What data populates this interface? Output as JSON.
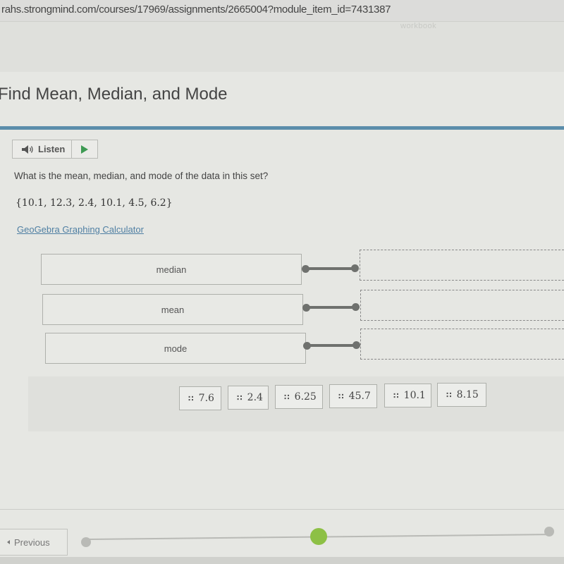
{
  "browser": {
    "url": "rahs.strongmind.com/courses/17969/assignments/2665004?module_item_id=7431387",
    "faded_tab_label": "workbook"
  },
  "page": {
    "title": "Find Mean, Median, and Mode",
    "accent_color": "#5b8dab"
  },
  "listen": {
    "label": "Listen",
    "speaker_icon": "speaker-icon",
    "play_icon": "play-icon",
    "play_color": "#3e9a53"
  },
  "question": {
    "prompt": "What is the mean, median, and mode of the data in this set?",
    "dataset": "{10.1, 12.3, 2.4, 10.1, 4.5, 6.2}",
    "calculator_link": "GeoGebra Graphing Calculator"
  },
  "matching": {
    "terms": [
      {
        "label": "median",
        "answer": ""
      },
      {
        "label": "mean",
        "answer": ""
      },
      {
        "label": "mode",
        "answer": ""
      }
    ]
  },
  "answer_bank": {
    "grip_icon": "drag-handle-icon",
    "options": [
      "7.6",
      "2.4",
      "6.25",
      "45.7",
      "10.1",
      "8.15"
    ]
  },
  "navigation": {
    "previous_label": "Previous",
    "progress": {
      "current_step_color": "#8dc045",
      "inactive_step_color": "#b9bab6"
    }
  }
}
